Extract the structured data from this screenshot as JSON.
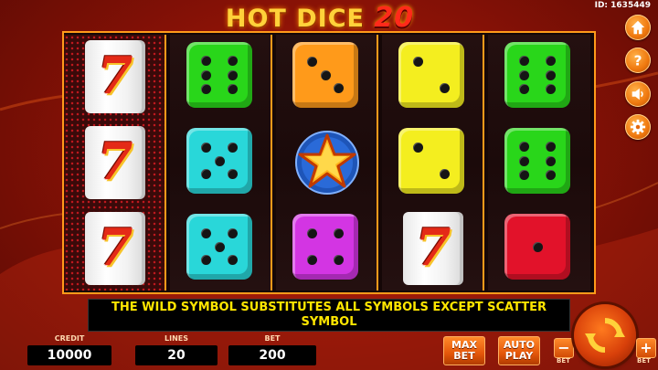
{
  "header": {
    "logo_main": "HOT DICE",
    "logo_number": "20",
    "game_id": "ID: 1635449"
  },
  "side_buttons": [
    {
      "name": "home-icon"
    },
    {
      "name": "help-icon"
    },
    {
      "name": "sound-icon"
    },
    {
      "name": "settings-icon"
    }
  ],
  "reels": [
    {
      "highlight": true,
      "symbols": [
        "seven",
        "seven",
        "seven"
      ]
    },
    {
      "highlight": false,
      "symbols": [
        "die-6-green",
        "die-5-cyan",
        "die-5-cyan"
      ]
    },
    {
      "highlight": false,
      "symbols": [
        "die-3-orange",
        "star-scatter",
        "die-4-magenta"
      ]
    },
    {
      "highlight": false,
      "symbols": [
        "die-2-yellow",
        "die-2-yellow",
        "seven"
      ]
    },
    {
      "highlight": false,
      "symbols": [
        "die-6-green",
        "die-6-green",
        "die-1-red"
      ]
    }
  ],
  "colors": {
    "green": "#29d61a",
    "cyan": "#29d7d9",
    "orange": "#ff9a1a",
    "magenta": "#d335e3",
    "yellow": "#f4ee1f",
    "red": "#e2122a",
    "frame": "#ff9a1a",
    "message_text": "#ffe600"
  },
  "message": "THE WILD SYMBOL SUBSTITUTES ALL SYMBOLS EXCEPT SCATTER SYMBOL",
  "panel": {
    "credit_label": "CREDIT",
    "credit_value": "10000",
    "lines_label": "LINES",
    "lines_value": "20",
    "bet_label": "BET",
    "bet_value": "200",
    "max_bet_line1": "MAX",
    "max_bet_line2": "BET",
    "auto_play_line1": "AUTO",
    "auto_play_line2": "PLAY",
    "bet_minus_symbol": "−",
    "bet_minus_label": "BET",
    "bet_plus_symbol": "+",
    "bet_plus_label": "BET",
    "spin_icon": "spin-icon"
  }
}
